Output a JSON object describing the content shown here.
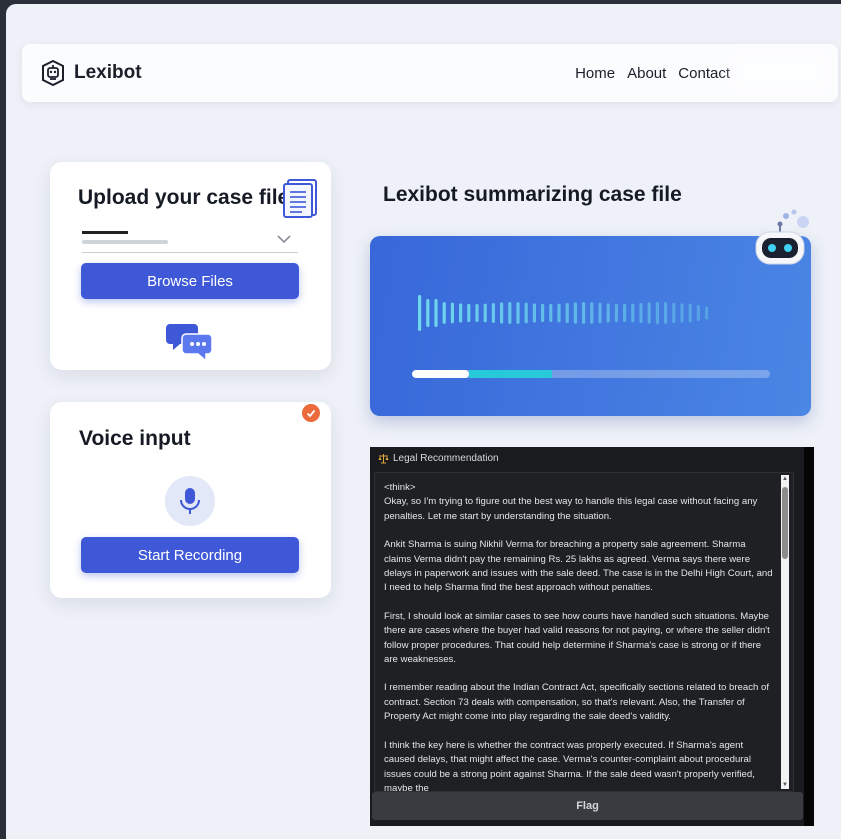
{
  "brand": {
    "name": "Lexibot"
  },
  "nav": {
    "links": [
      "Home",
      "About",
      "Contact"
    ]
  },
  "upload": {
    "title": "Upload your case file",
    "browse_label": "Browse Files"
  },
  "voice": {
    "title": "Voice input",
    "record_label": "Start Recording"
  },
  "summary": {
    "title": "Lexibot summarizing case file",
    "progress_white": 0.16,
    "progress_cyan": 0.39
  },
  "legal": {
    "header": "Legal Recommendation",
    "think_tag": "<think>",
    "paragraphs": [
      "Okay, so I'm trying to figure out the best way to handle this legal case without facing any penalties. Let me start by understanding the situation.",
      "Ankit Sharma is suing Nikhil Verma for breaching a property sale agreement. Sharma claims Verma didn't pay the remaining Rs. 25 lakhs as agreed. Verma says there were delays in paperwork and issues with the sale deed. The case is in the Delhi High Court, and I need to help Sharma find the best approach without penalties.",
      "First, I should look at similar cases to see how courts have handled such situations. Maybe there are cases where the buyer had valid reasons for not paying, or where the seller didn't follow proper procedures. That could help determine if Sharma's case is strong or if there are weaknesses.",
      "I remember reading about the Indian Contract Act, specifically sections related to breach of contract. Section 73 deals with compensation, so that's relevant. Also, the Transfer of Property Act might come into play regarding the sale deed's validity.",
      "I think the key here is whether the contract was properly executed. If Sharma's agent caused delays, that might affect the case. Verma's counter-complaint about procedural issues could be a strong point against Sharma. If the sale deed wasn't properly verified, maybe the"
    ],
    "flag_label": "Flag"
  },
  "colors": {
    "accent": "#3f58d8",
    "panel_gradient_start": "#3867d9",
    "panel_gradient_end": "#4a86e4",
    "progress_cyan": "#28c9d8",
    "badge": "#ec6a3c"
  },
  "icons": {
    "brand": "robot-head-icon",
    "document": "document-icon",
    "chat": "chat-bubbles-icon",
    "mic": "microphone-icon",
    "check": "check-badge-icon",
    "robot": "robot-mascot-icon",
    "scale": "scale-icon"
  }
}
